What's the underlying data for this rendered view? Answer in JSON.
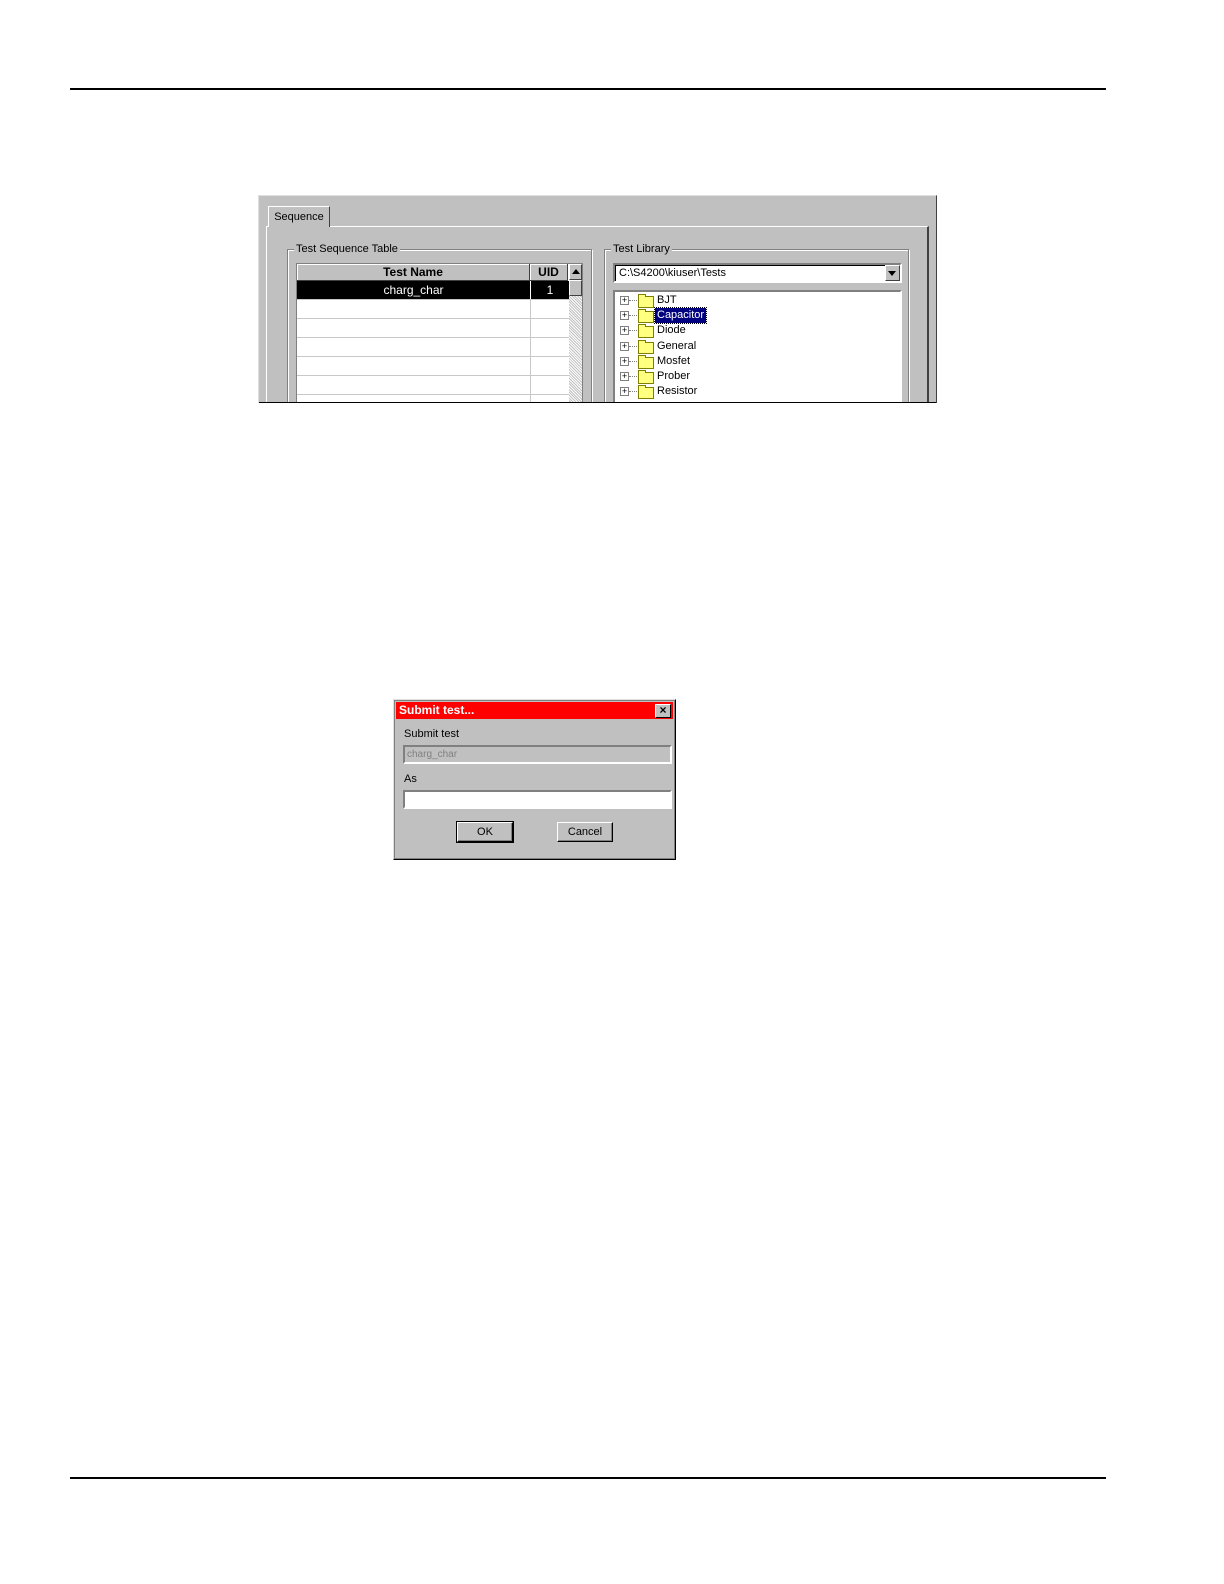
{
  "sequence_window": {
    "tab_label": "Sequence",
    "sequence_table": {
      "group_label": "Test Sequence Table",
      "columns": [
        "Test Name",
        "UID"
      ],
      "rows": [
        {
          "test_name": "charg_char",
          "uid": "1",
          "selected": true
        }
      ]
    },
    "test_library": {
      "group_label": "Test Library",
      "path": "C:\\S4200\\kiuser\\Tests",
      "folders": [
        {
          "label": "BJT",
          "selected": false
        },
        {
          "label": "Capacitor",
          "selected": true
        },
        {
          "label": "Diode",
          "selected": false
        },
        {
          "label": "General",
          "selected": false
        },
        {
          "label": "Mosfet",
          "selected": false
        },
        {
          "label": "Prober",
          "selected": false
        },
        {
          "label": "Resistor",
          "selected": false
        }
      ]
    }
  },
  "submit_dialog": {
    "title": "Submit test...",
    "submit_label": "Submit test",
    "submit_value": "charg_char",
    "as_label": "As",
    "as_value": "",
    "ok_label": "OK",
    "cancel_label": "Cancel",
    "title_bar_color": "#ff0000"
  }
}
